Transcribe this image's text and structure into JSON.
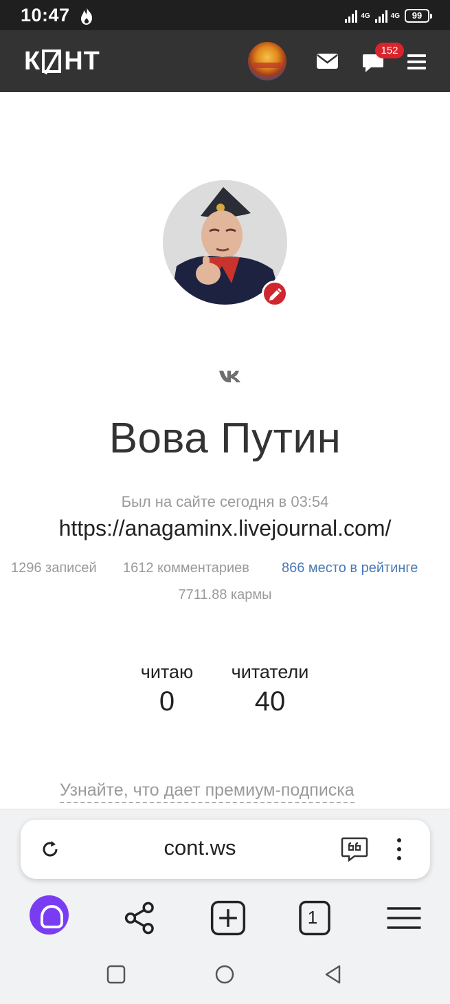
{
  "status_bar": {
    "time": "10:47",
    "network_1": "4G",
    "network_2": "4G",
    "battery": "99"
  },
  "header": {
    "logo": "КОНТ",
    "logo_before": "К",
    "logo_after": "НТ",
    "notifications_count": "152",
    "icons": [
      "mail-icon",
      "chat-icon",
      "menu-icon"
    ]
  },
  "profile": {
    "name": "Вова Путин",
    "last_seen": "Был на сайте сегодня в 03:54",
    "link": "https://anagaminx.livejournal.com/",
    "stats": {
      "posts": "1296 записей",
      "comments": "1612 комментариев",
      "rating": "866 место в рейтинге",
      "karma": "7711.88 кармы"
    },
    "follow": {
      "reading_label": "читаю",
      "reading_count": "0",
      "readers_label": "читатели",
      "readers_count": "40"
    },
    "premium_link": "Узнайте, что дает премиум-подписка"
  },
  "browser": {
    "url": "cont.ws",
    "tabs_count": "1"
  },
  "colors": {
    "header_bg": "#333333",
    "badge": "#d8242c",
    "rating_link": "#4a7ab6",
    "alice": "#7a3cf2"
  }
}
